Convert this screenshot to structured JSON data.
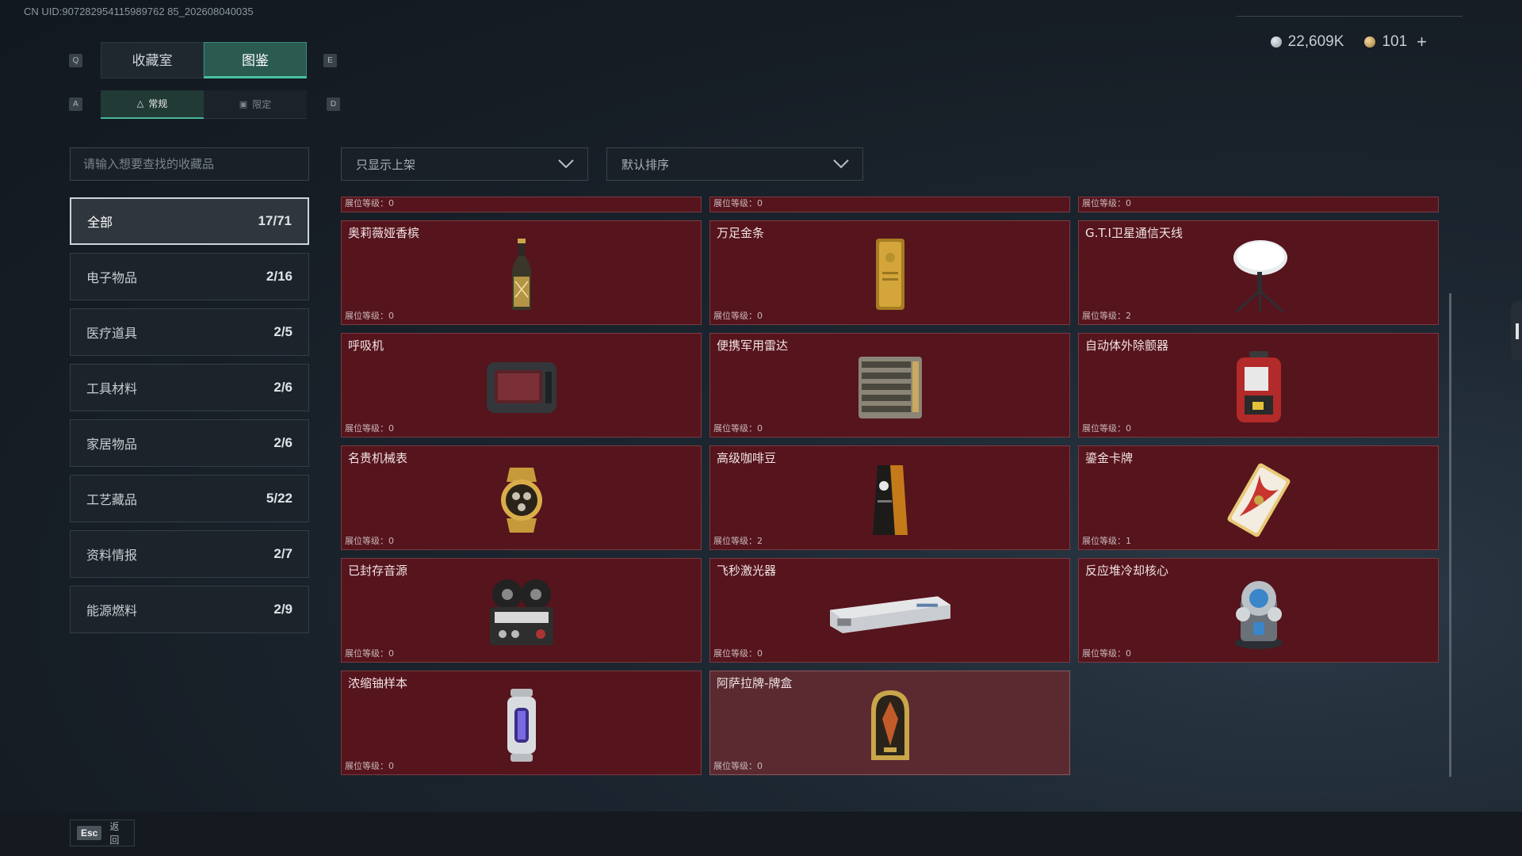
{
  "uid": "CN UID:907282954115989762 85_202608040035",
  "currency": {
    "silver": "22,609K",
    "gold": "101",
    "plus": "+"
  },
  "keys": {
    "q": "Q",
    "e": "E",
    "a": "A",
    "d": "D"
  },
  "tabs": [
    {
      "label": "收藏室"
    },
    {
      "label": "图鉴",
      "active": true
    }
  ],
  "subtabs": [
    {
      "label": "常规",
      "active": true
    },
    {
      "label": "限定"
    }
  ],
  "search": {
    "placeholder": "请输入想要查找的收藏品"
  },
  "filters": {
    "shelf": "只显示上架",
    "sort": "默认排序"
  },
  "categories": [
    {
      "label": "全部",
      "count": "17/71",
      "active": true
    },
    {
      "label": "电子物品",
      "count": "2/16"
    },
    {
      "label": "医疗道具",
      "count": "2/5"
    },
    {
      "label": "工具材料",
      "count": "2/6"
    },
    {
      "label": "家居物品",
      "count": "2/6"
    },
    {
      "label": "工艺藏品",
      "count": "5/22"
    },
    {
      "label": "资料情报",
      "count": "2/7"
    },
    {
      "label": "能源燃料",
      "count": "2/9"
    }
  ],
  "items": [
    {
      "name": "",
      "level": "展位等级：0",
      "icon": "partial",
      "partial": true
    },
    {
      "name": "",
      "level": "展位等级：0",
      "icon": "partial",
      "partial": true
    },
    {
      "name": "",
      "level": "展位等级：0",
      "icon": "partial",
      "partial": true
    },
    {
      "name": "奥莉薇娅香槟",
      "level": "展位等级：0",
      "icon": "champagne-bottle-icon"
    },
    {
      "name": "万足金条",
      "level": "展位等级：0",
      "icon": "gold-bar-icon"
    },
    {
      "name": "G.T.I卫星通信天线",
      "level": "展位等级：2",
      "icon": "satellite-dish-icon"
    },
    {
      "name": "呼吸机",
      "level": "展位等级：0",
      "icon": "ventilator-icon"
    },
    {
      "name": "便携军用雷达",
      "level": "展位等级：0",
      "icon": "radar-icon"
    },
    {
      "name": "自动体外除颤器",
      "level": "展位等级：0",
      "icon": "defibrillator-icon"
    },
    {
      "name": "名贵机械表",
      "level": "展位等级：0",
      "icon": "watch-icon"
    },
    {
      "name": "高级咖啡豆",
      "level": "展位等级：2",
      "icon": "coffee-bag-icon"
    },
    {
      "name": "鎏金卡牌",
      "level": "展位等级：1",
      "icon": "gilded-card-icon"
    },
    {
      "name": "已封存音源",
      "level": "展位等级：0",
      "icon": "reel-recorder-icon"
    },
    {
      "name": "飞秒激光器",
      "level": "展位等级：0",
      "icon": "laser-device-icon"
    },
    {
      "name": "反应堆冷却核心",
      "level": "展位等级：0",
      "icon": "reactor-core-icon"
    },
    {
      "name": "浓缩铀样本",
      "level": "展位等级：0",
      "icon": "uranium-canister-icon"
    },
    {
      "name": "阿萨拉牌-牌盒",
      "level": "展位等级：0",
      "icon": "card-box-icon",
      "selected": true
    }
  ],
  "footer": {
    "esc_key": "Esc",
    "back": "返回"
  },
  "colors": {
    "card_bg": "#56141c",
    "accent": "#49c2a3"
  }
}
